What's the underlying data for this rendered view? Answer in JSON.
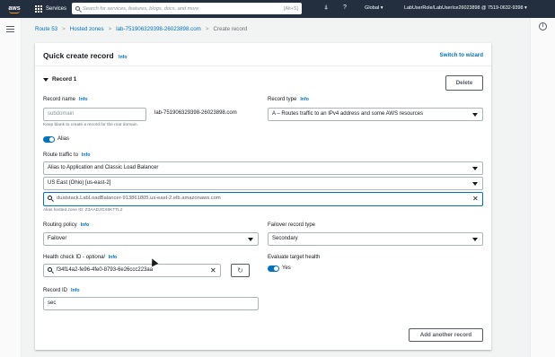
{
  "topnav": {
    "logo": "aws",
    "services_label": "Services",
    "search_placeholder": "Search for services, features, blogs, docs, and more",
    "search_shortcut": "[Alt+S]",
    "region": "Global ▾",
    "account": "LabUserRole/LabUserIce26023898 @ 7519-0632-9398 ▾",
    "icons": [
      "bell-icon",
      "help-icon"
    ]
  },
  "breadcrumb": {
    "items": [
      "Route 53",
      "Hosted zones",
      "lab-751906329398-26023898.com",
      "Create record"
    ],
    "separator": ">"
  },
  "panel": {
    "title": "Quick create record",
    "info": "Info",
    "switch_wizard": "Switch to wizard",
    "record_heading": "Record 1",
    "delete_label": "Delete",
    "add_record_label": "Add another record"
  },
  "form": {
    "record_name": {
      "label": "Record name",
      "info": "Info",
      "placeholder": "subdomain",
      "suffix": "lab-751906329398-26023898.com",
      "hint": "Keep blank to create a record for the root domain."
    },
    "record_type": {
      "label": "Record type",
      "info": "Info",
      "value": "A – Routes traffic to an IPv4 address and some AWS resources"
    },
    "alias": {
      "label": "Alias",
      "on": true
    },
    "route_traffic": {
      "label": "Route traffic to",
      "info": "Info",
      "endpoint": "Alias to Application and Classic Load Balancer",
      "region": "US East (Ohio) [us-east-2]",
      "target": "dualstack.LabLoadBalancer-913861805.us-east-2.elb.amazonaws.com",
      "hosted_zone_hint": "Alias hosted zone ID: Z3AADJGX6KTTL2"
    },
    "routing_policy": {
      "label": "Routing policy",
      "info": "Info",
      "value": "Failover"
    },
    "failover_type": {
      "label": "Failover record type",
      "value": "Secondary"
    },
    "health_check": {
      "label_main": "Health check ID - ",
      "label_optional": "optional",
      "info": "Info",
      "value": "f34f14a2-fe96-4fe0-8793-6e26ccc223aa"
    },
    "evaluate_health": {
      "label": "Evaluate target health",
      "value": "Yes",
      "on": true
    },
    "record_id": {
      "label": "Record ID",
      "info": "Info",
      "value": "sec"
    }
  },
  "colors": {
    "nav_bg": "#232f3e",
    "link": "#0073bb",
    "accent": "#ff9900"
  }
}
